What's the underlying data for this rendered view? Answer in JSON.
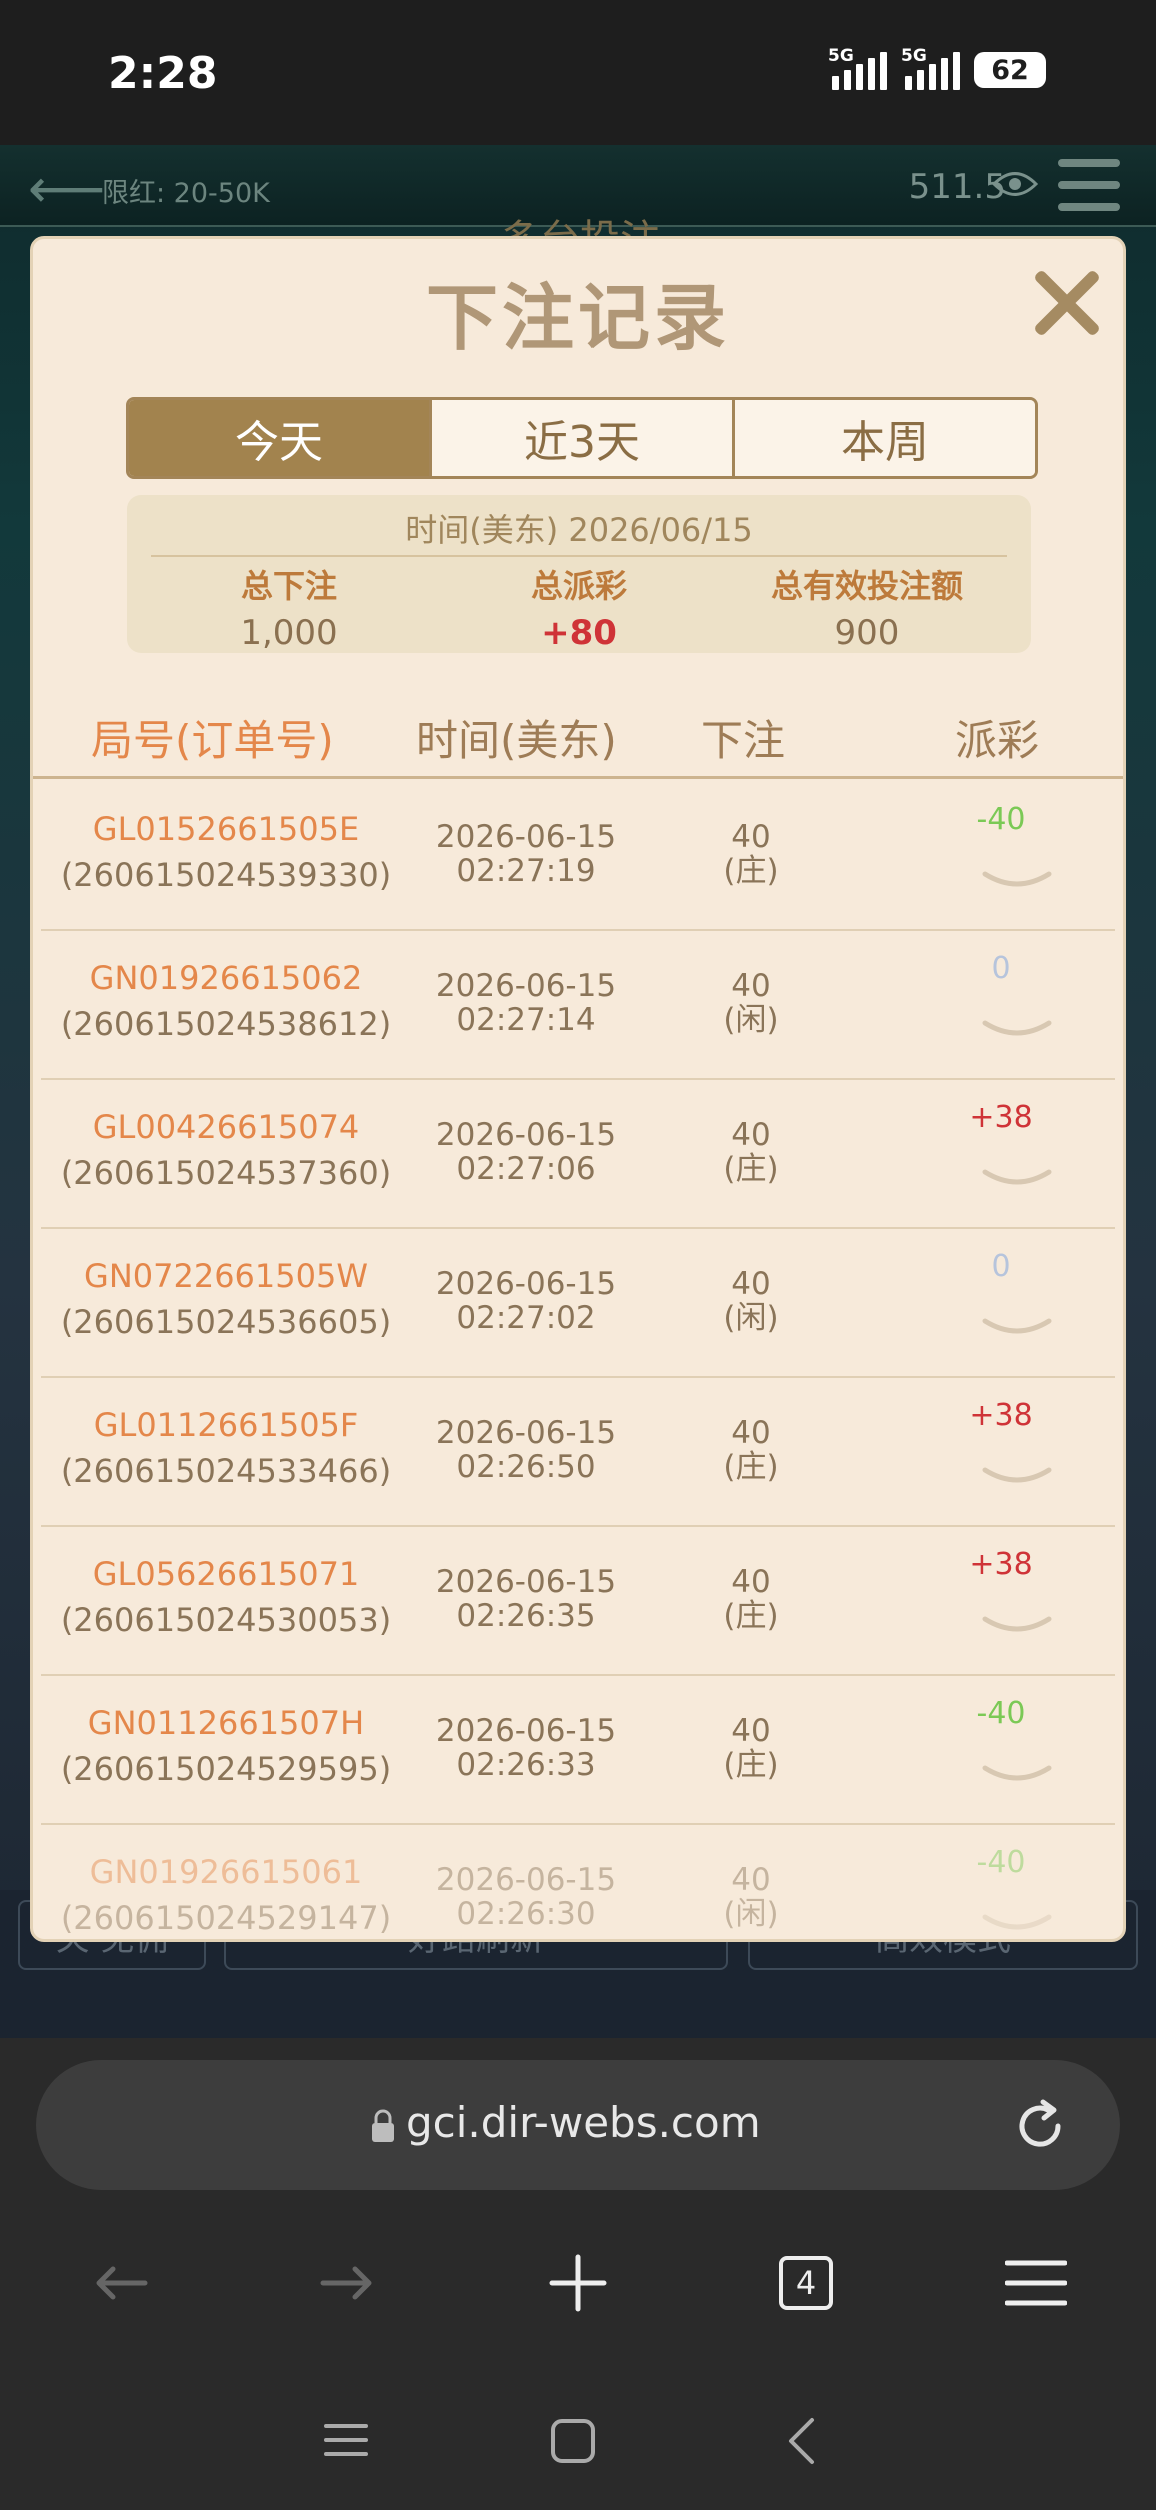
{
  "status_bar": {
    "time": "2:28",
    "net1": "5G",
    "net2": "5G",
    "battery": "62"
  },
  "game": {
    "limit": "限红: 20-50K",
    "balance": "511.5",
    "title": "多台投注",
    "bottom_buttons": [
      "关 免佣",
      "好路刷新",
      "高效模式"
    ]
  },
  "modal": {
    "title": "下注记录",
    "tabs": [
      {
        "label": "今天",
        "active": true
      },
      {
        "label": "近3天",
        "active": false
      },
      {
        "label": "本周",
        "active": false
      }
    ],
    "summary": {
      "date": "时间(美东) 2026/06/15",
      "total_bet_label": "总下注",
      "total_bet": "1,000",
      "total_payout_label": "总派彩",
      "total_payout": "+80",
      "valid_bet_label": "总有效投注额",
      "valid_bet": "900"
    },
    "headers": {
      "id": "局号(订单号)",
      "time": "时间(美东)",
      "bet": "下注",
      "payout": "派彩"
    },
    "rows": [
      {
        "game_id": "GL0152661505E",
        "order_id": "(260615024539330)",
        "date": "2026-06-15",
        "time": "02:27:19",
        "amount": "40",
        "side": "(庄)",
        "payout": "-40",
        "kind": "neg"
      },
      {
        "game_id": "GN01926615062",
        "order_id": "(260615024538612)",
        "date": "2026-06-15",
        "time": "02:27:14",
        "amount": "40",
        "side": "(闲)",
        "payout": "0",
        "kind": "zero"
      },
      {
        "game_id": "GL00426615074",
        "order_id": "(260615024537360)",
        "date": "2026-06-15",
        "time": "02:27:06",
        "amount": "40",
        "side": "(庄)",
        "payout": "+38",
        "kind": "pos"
      },
      {
        "game_id": "GN0722661505W",
        "order_id": "(260615024536605)",
        "date": "2026-06-15",
        "time": "02:27:02",
        "amount": "40",
        "side": "(闲)",
        "payout": "0",
        "kind": "zero"
      },
      {
        "game_id": "GL0112661505F",
        "order_id": "(260615024533466)",
        "date": "2026-06-15",
        "time": "02:26:50",
        "amount": "40",
        "side": "(庄)",
        "payout": "+38",
        "kind": "pos"
      },
      {
        "game_id": "GL05626615071",
        "order_id": "(260615024530053)",
        "date": "2026-06-15",
        "time": "02:26:35",
        "amount": "40",
        "side": "(庄)",
        "payout": "+38",
        "kind": "pos"
      },
      {
        "game_id": "GN0112661507H",
        "order_id": "(260615024529595)",
        "date": "2026-06-15",
        "time": "02:26:33",
        "amount": "40",
        "side": "(庄)",
        "payout": "-40",
        "kind": "neg"
      },
      {
        "game_id": "GN01926615061",
        "order_id": "(260615024529147)",
        "date": "2026-06-15",
        "time": "02:26:30",
        "amount": "40",
        "side": "(闲)",
        "payout": "-40",
        "kind": "neg"
      }
    ]
  },
  "browser": {
    "url": "gci.dir-webs.com",
    "tab_count": "4"
  }
}
